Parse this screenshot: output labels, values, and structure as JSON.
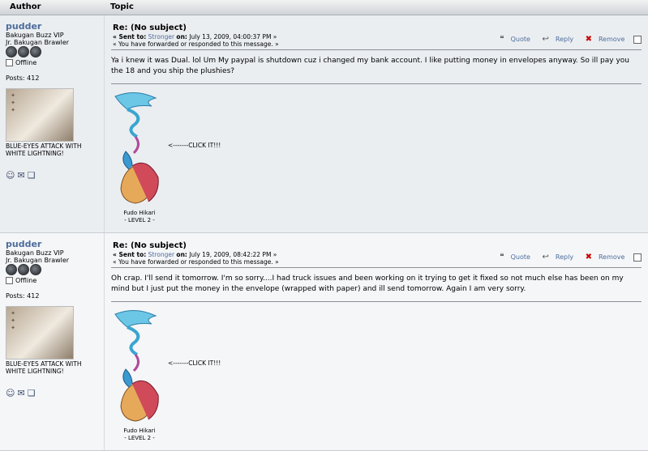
{
  "header": {
    "author": "Author",
    "topic": "Topic"
  },
  "posts": [
    {
      "author": "pudder",
      "group": "Bakugan Buzz VIP",
      "rank": "Jr. Bakugan Brawler",
      "status": "Offline",
      "post_count": "Posts: 412",
      "signature": "BLUE-EYES ATTACK WITH WHITE LIGHTNING!",
      "title": "Re: (No subject)",
      "sent_prefix": "« Sent to:",
      "recipient": "Stronger",
      "on_label": "on:",
      "date": "July 13, 2009, 04:00:37 PM »",
      "forward_note": "« You have forwarded or responded to this message. »",
      "message": "Ya i knew it was Dual. lol Um My paypal is shutdown cuz i changed my bank account. I like putting money in envelopes anyway. So ill pay you the 18 and you ship the plushies?",
      "sig_click": "<-------CLICK IT!!!",
      "sig_name": "Fudo Hikari",
      "sig_level": "- LEVEL 2 -"
    },
    {
      "author": "pudder",
      "group": "Bakugan Buzz VIP",
      "rank": "Jr. Bakugan Brawler",
      "status": "Offline",
      "post_count": "Posts: 412",
      "signature": "BLUE-EYES ATTACK WITH WHITE LIGHTNING!",
      "title": "Re: (No subject)",
      "sent_prefix": "« Sent to:",
      "recipient": "Stronger",
      "on_label": "on:",
      "date": "July 19, 2009, 08:42:22 PM »",
      "forward_note": "« You have forwarded or responded to this message. »",
      "message": "Oh crap. I'll send it tomorrow. I'm so sorry....I had truck issues and been working on it trying to get it fixed so not much else has been on my mind but I just put the money in the envelope (wrapped with paper) and ill send tomorrow. Again I am very sorry.",
      "sig_click": "<-------CLICK IT!!!",
      "sig_name": "Fudo Hikari",
      "sig_level": "- LEVEL 2 -"
    }
  ],
  "actions": {
    "quote": "Quote",
    "reply": "Reply",
    "remove": "Remove"
  },
  "icons": {
    "quote": "quote-icon",
    "reply": "reply-icon",
    "remove": "remove-icon",
    "profile": "profile-icon",
    "email": "email-icon",
    "pm": "pm-icon"
  }
}
